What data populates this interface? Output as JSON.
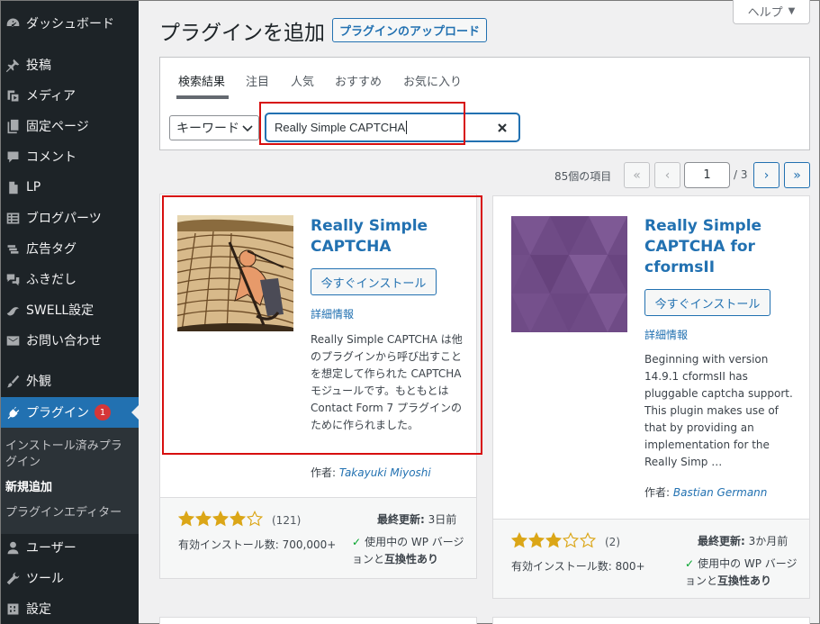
{
  "sidebar": {
    "items": [
      {
        "label": "ダッシュボード",
        "icon": "dashboard-icon"
      },
      {
        "label": "投稿",
        "icon": "pin-icon"
      },
      {
        "label": "メディア",
        "icon": "media-icon"
      },
      {
        "label": "固定ページ",
        "icon": "page-icon"
      },
      {
        "label": "コメント",
        "icon": "comment-icon"
      },
      {
        "label": "LP",
        "icon": "document-icon"
      },
      {
        "label": "ブログパーツ",
        "icon": "table-icon"
      },
      {
        "label": "広告タグ",
        "icon": "stack-icon"
      },
      {
        "label": "ふきだし",
        "icon": "speech-bubble-icon"
      },
      {
        "label": "SWELL設定",
        "icon": "swell-icon"
      },
      {
        "label": "お問い合わせ",
        "icon": "mail-icon"
      },
      {
        "label": "外観",
        "icon": "brush-icon"
      },
      {
        "label": "プラグイン",
        "icon": "plugin-icon",
        "badge": "1"
      },
      {
        "label": "ユーザー",
        "icon": "user-icon"
      },
      {
        "label": "ツール",
        "icon": "wrench-icon"
      },
      {
        "label": "設定",
        "icon": "settings-icon"
      }
    ],
    "submenu": [
      "インストール済みプラグイン",
      "新規追加",
      "プラグインエディター"
    ]
  },
  "header": {
    "title": "プラグインを追加",
    "upload_label": "プラグインのアップロード",
    "help_label": "ヘルプ"
  },
  "filter": {
    "tabs": [
      "検索結果",
      "注目",
      "人気",
      "おすすめ",
      "お気に入り"
    ],
    "search_type": "キーワード",
    "search_value": "Really Simple CAPTCHA"
  },
  "pagination": {
    "items_count": "85個の項目",
    "first": "«",
    "prev": "‹",
    "current_page": "1",
    "total": "/ 3",
    "next": "›",
    "last": "»"
  },
  "plugins": [
    {
      "name": "Really Simple CAPTCHA",
      "install": "今すぐインストール",
      "details": "詳細情報",
      "description": "Really Simple CAPTCHA は他のプラグインから呼び出すことを想定して作られた CAPTCHA モジュールです。もともとは Contact Form 7 プラグインのために作られました。",
      "author_label": "作者:",
      "author": "Takayuki Miyoshi",
      "rating": 4,
      "rating_count": "(121)",
      "last_updated_label": "最終更新:",
      "last_updated": "3日前",
      "installs": "有効インストール数: 700,000+",
      "compat_prefix": "使用中の WP バージョンと",
      "compat_bold": "互換性あり"
    },
    {
      "name": "Really Simple CAPTCHA for cformsII",
      "install": "今すぐインストール",
      "details": "詳細情報",
      "description": "Beginning with version 14.9.1 cformsII has pluggable captcha support. This plugin makes use of that by providing an implementation for the Really Simp …",
      "author_label": "作者:",
      "author": "Bastian Germann",
      "rating": 3,
      "rating_count": "(2)",
      "last_updated_label": "最終更新:",
      "last_updated": "3か月前",
      "installs": "有効インストール数: 800+",
      "compat_prefix": "使用中の WP バージョンと",
      "compat_bold": "互換性あり"
    }
  ],
  "colors": {
    "accent": "#2271b1",
    "sidebar_bg": "#1d2327",
    "highlight": "#d70f0f",
    "star": "#dba617"
  }
}
